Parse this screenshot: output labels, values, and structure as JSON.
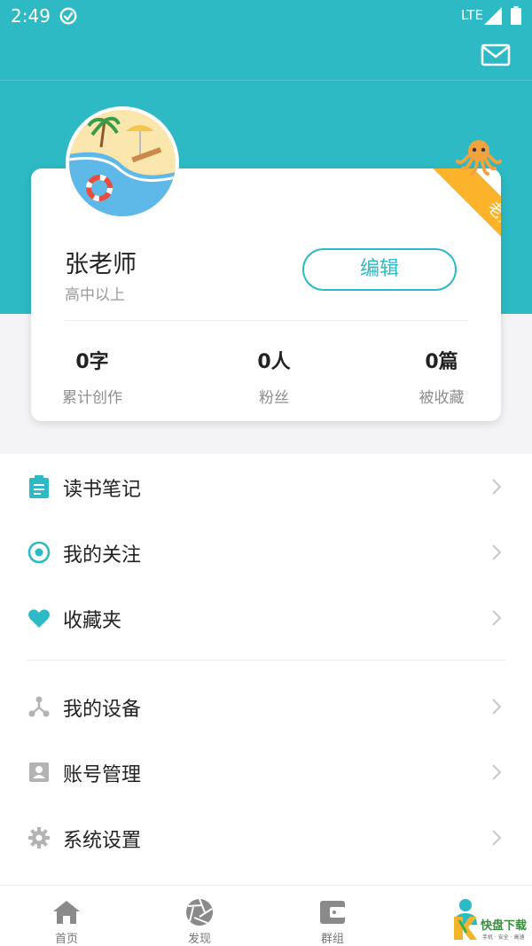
{
  "status_bar": {
    "time": "2:49",
    "network": "LTE"
  },
  "profile": {
    "name": "张老师",
    "grade": "高中以上",
    "role_badge": "老师",
    "edit_label": "编辑",
    "stats": [
      {
        "value": "0字",
        "label": "累计创作"
      },
      {
        "value": "0人",
        "label": "粉丝"
      },
      {
        "value": "0篇",
        "label": "被收藏"
      }
    ]
  },
  "menu": {
    "items": [
      {
        "label": "读书笔记",
        "icon": "clipboard-icon"
      },
      {
        "label": "我的关注",
        "icon": "target-icon"
      },
      {
        "label": "收藏夹",
        "icon": "heart-icon"
      },
      {
        "label": "我的设备",
        "icon": "device-network-icon"
      },
      {
        "label": "账号管理",
        "icon": "account-card-icon"
      },
      {
        "label": "系统设置",
        "icon": "gear-icon"
      }
    ]
  },
  "bottom_nav": {
    "items": [
      {
        "label": "首页",
        "icon": "home-icon"
      },
      {
        "label": "发现",
        "icon": "aperture-icon"
      },
      {
        "label": "群组",
        "icon": "wallet-icon"
      },
      {
        "label": "",
        "icon": "person-icon"
      }
    ]
  },
  "watermark": {
    "main": "快盘下载",
    "sub": "手机 · 安全 · 高速"
  },
  "colors": {
    "brand": "#2dbac4",
    "ribbon": "#fab32a",
    "text_primary": "#222222",
    "text_secondary": "#9a9a9a"
  }
}
